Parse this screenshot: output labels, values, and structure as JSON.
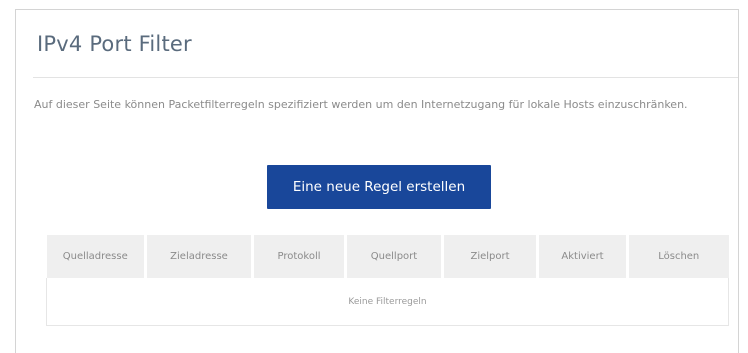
{
  "page": {
    "title": "IPv4 Port Filter",
    "description": "Auf dieser Seite können Packetfilterregeln spezifiziert werden um den Internetzugang für lokale Hosts einzuschränken."
  },
  "actions": {
    "create_rule_label": "Eine neue Regel erstellen",
    "create_rule_color": "#19479a"
  },
  "filter_table": {
    "columns": [
      "Quelladresse",
      "Zieladresse",
      "Protokoll",
      "Quellport",
      "Zielport",
      "Aktiviert",
      "Löschen"
    ],
    "empty_message": "Keine Filterregeln"
  }
}
